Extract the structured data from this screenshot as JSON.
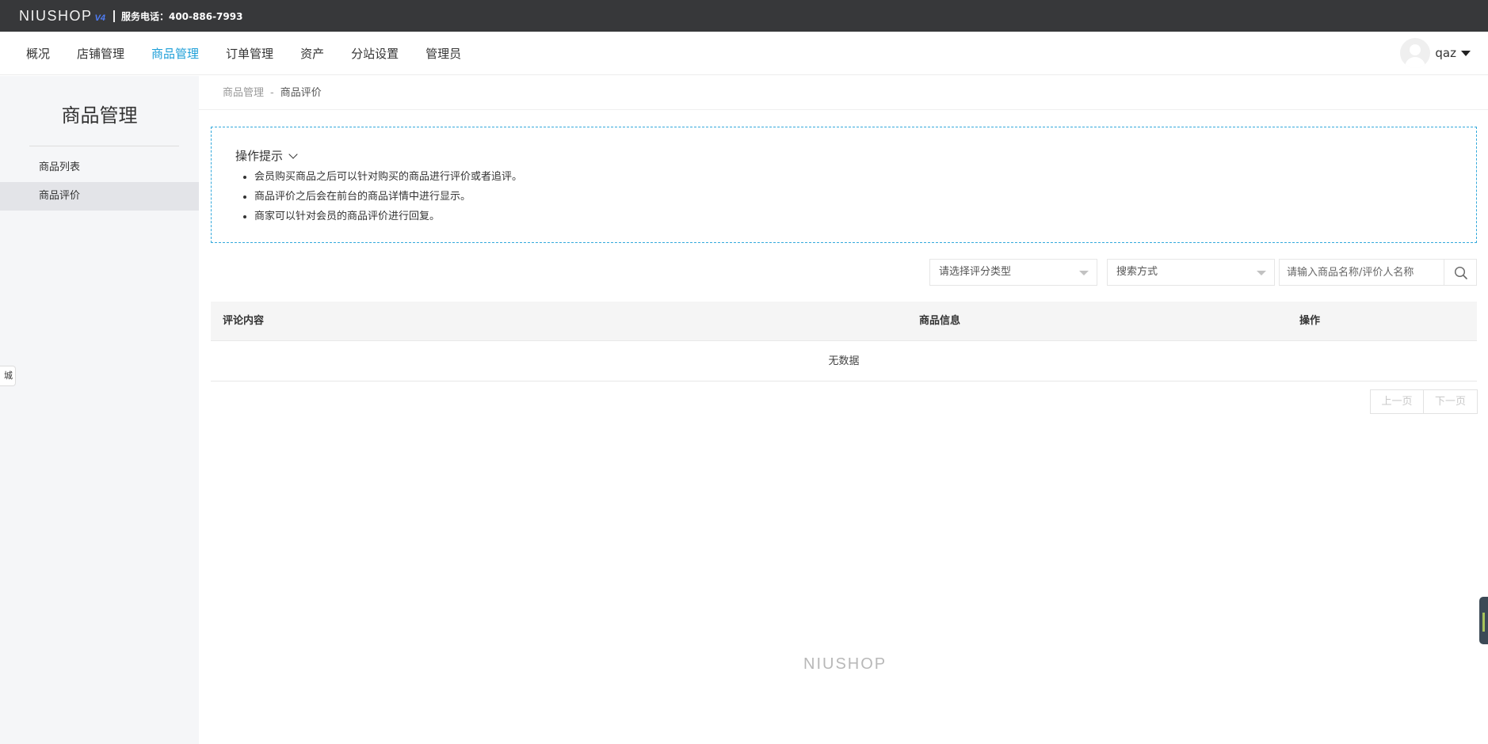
{
  "topbar": {
    "logo_text": "NIUSHOP",
    "logo_version": "V4",
    "phone": "服务电话：400-886-7993"
  },
  "nav": {
    "items": [
      {
        "label": "概况",
        "active": false
      },
      {
        "label": "店铺管理",
        "active": false
      },
      {
        "label": "商品管理",
        "active": true
      },
      {
        "label": "订单管理",
        "active": false
      },
      {
        "label": "资产",
        "active": false
      },
      {
        "label": "分站设置",
        "active": false
      },
      {
        "label": "管理员",
        "active": false
      }
    ],
    "user": {
      "name": "qaz",
      "avatar_icon": "user-avatar-icon"
    }
  },
  "sidebar": {
    "title": "商品管理",
    "items": [
      {
        "label": "商品列表",
        "active": false
      },
      {
        "label": "商品评价",
        "active": true
      }
    ],
    "float_tab": "城"
  },
  "breadcrumb": {
    "parent": "商品管理",
    "separator": "-",
    "current": "商品评价"
  },
  "tips": {
    "title": "操作提示",
    "items": [
      "会员购买商品之后可以针对购买的商品进行评价或者追评。",
      "商品评价之后会在前台的商品详情中进行显示。",
      "商家可以针对会员的商品评价进行回复。"
    ]
  },
  "filters": {
    "rating_type_placeholder": "请选择评分类型",
    "search_mode_placeholder": "搜索方式",
    "search_placeholder": "请输入商品名称/评价人名称"
  },
  "table": {
    "columns": [
      "评论内容",
      "商品信息",
      "操作"
    ],
    "empty_text": "无数据"
  },
  "pager": {
    "prev": "上一页",
    "next": "下一页"
  },
  "footer": {
    "logo_text": "NIUSHOP"
  },
  "colors": {
    "accent": "#1e9fd8",
    "topbar_bg": "#37383a",
    "tips_border": "#34a9dc"
  }
}
